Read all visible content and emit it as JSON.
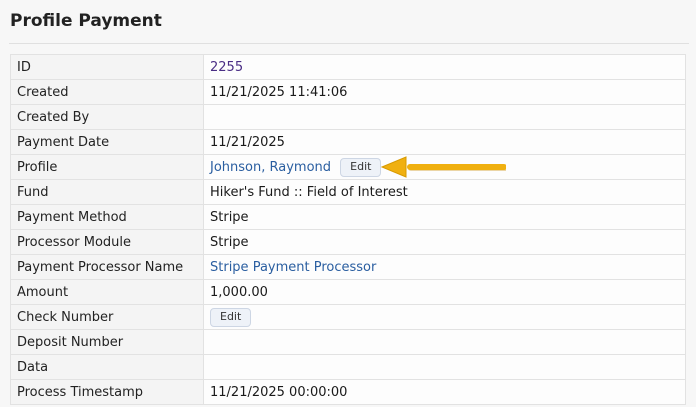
{
  "page": {
    "title": "Profile Payment"
  },
  "details": {
    "id": {
      "label": "ID",
      "value": "2255"
    },
    "created": {
      "label": "Created",
      "value": "11/21/2025 11:41:06"
    },
    "created_by": {
      "label": "Created By",
      "value": ""
    },
    "payment_date": {
      "label": "Payment Date",
      "value": "11/21/2025"
    },
    "profile": {
      "label": "Profile",
      "value": "Johnson, Raymond",
      "edit_label": "Edit"
    },
    "fund": {
      "label": "Fund",
      "value": "Hiker's Fund :: Field of Interest"
    },
    "payment_method": {
      "label": "Payment Method",
      "value": "Stripe"
    },
    "processor_module": {
      "label": "Processor Module",
      "value": "Stripe"
    },
    "payment_processor_name": {
      "label": "Payment Processor Name",
      "value": "Stripe Payment Processor"
    },
    "amount": {
      "label": "Amount",
      "value": "1,000.00"
    },
    "check_number": {
      "label": "Check Number",
      "edit_label": "Edit"
    },
    "deposit_number": {
      "label": "Deposit Number",
      "value": ""
    },
    "data": {
      "label": "Data",
      "value": ""
    },
    "process_timestamp": {
      "label": "Process Timestamp",
      "value": "11/21/2025 00:00:00"
    }
  },
  "colors": {
    "link": "#2a5ea0",
    "visited_link": "#4a2e85",
    "annotation_arrow": "#f0b010"
  }
}
